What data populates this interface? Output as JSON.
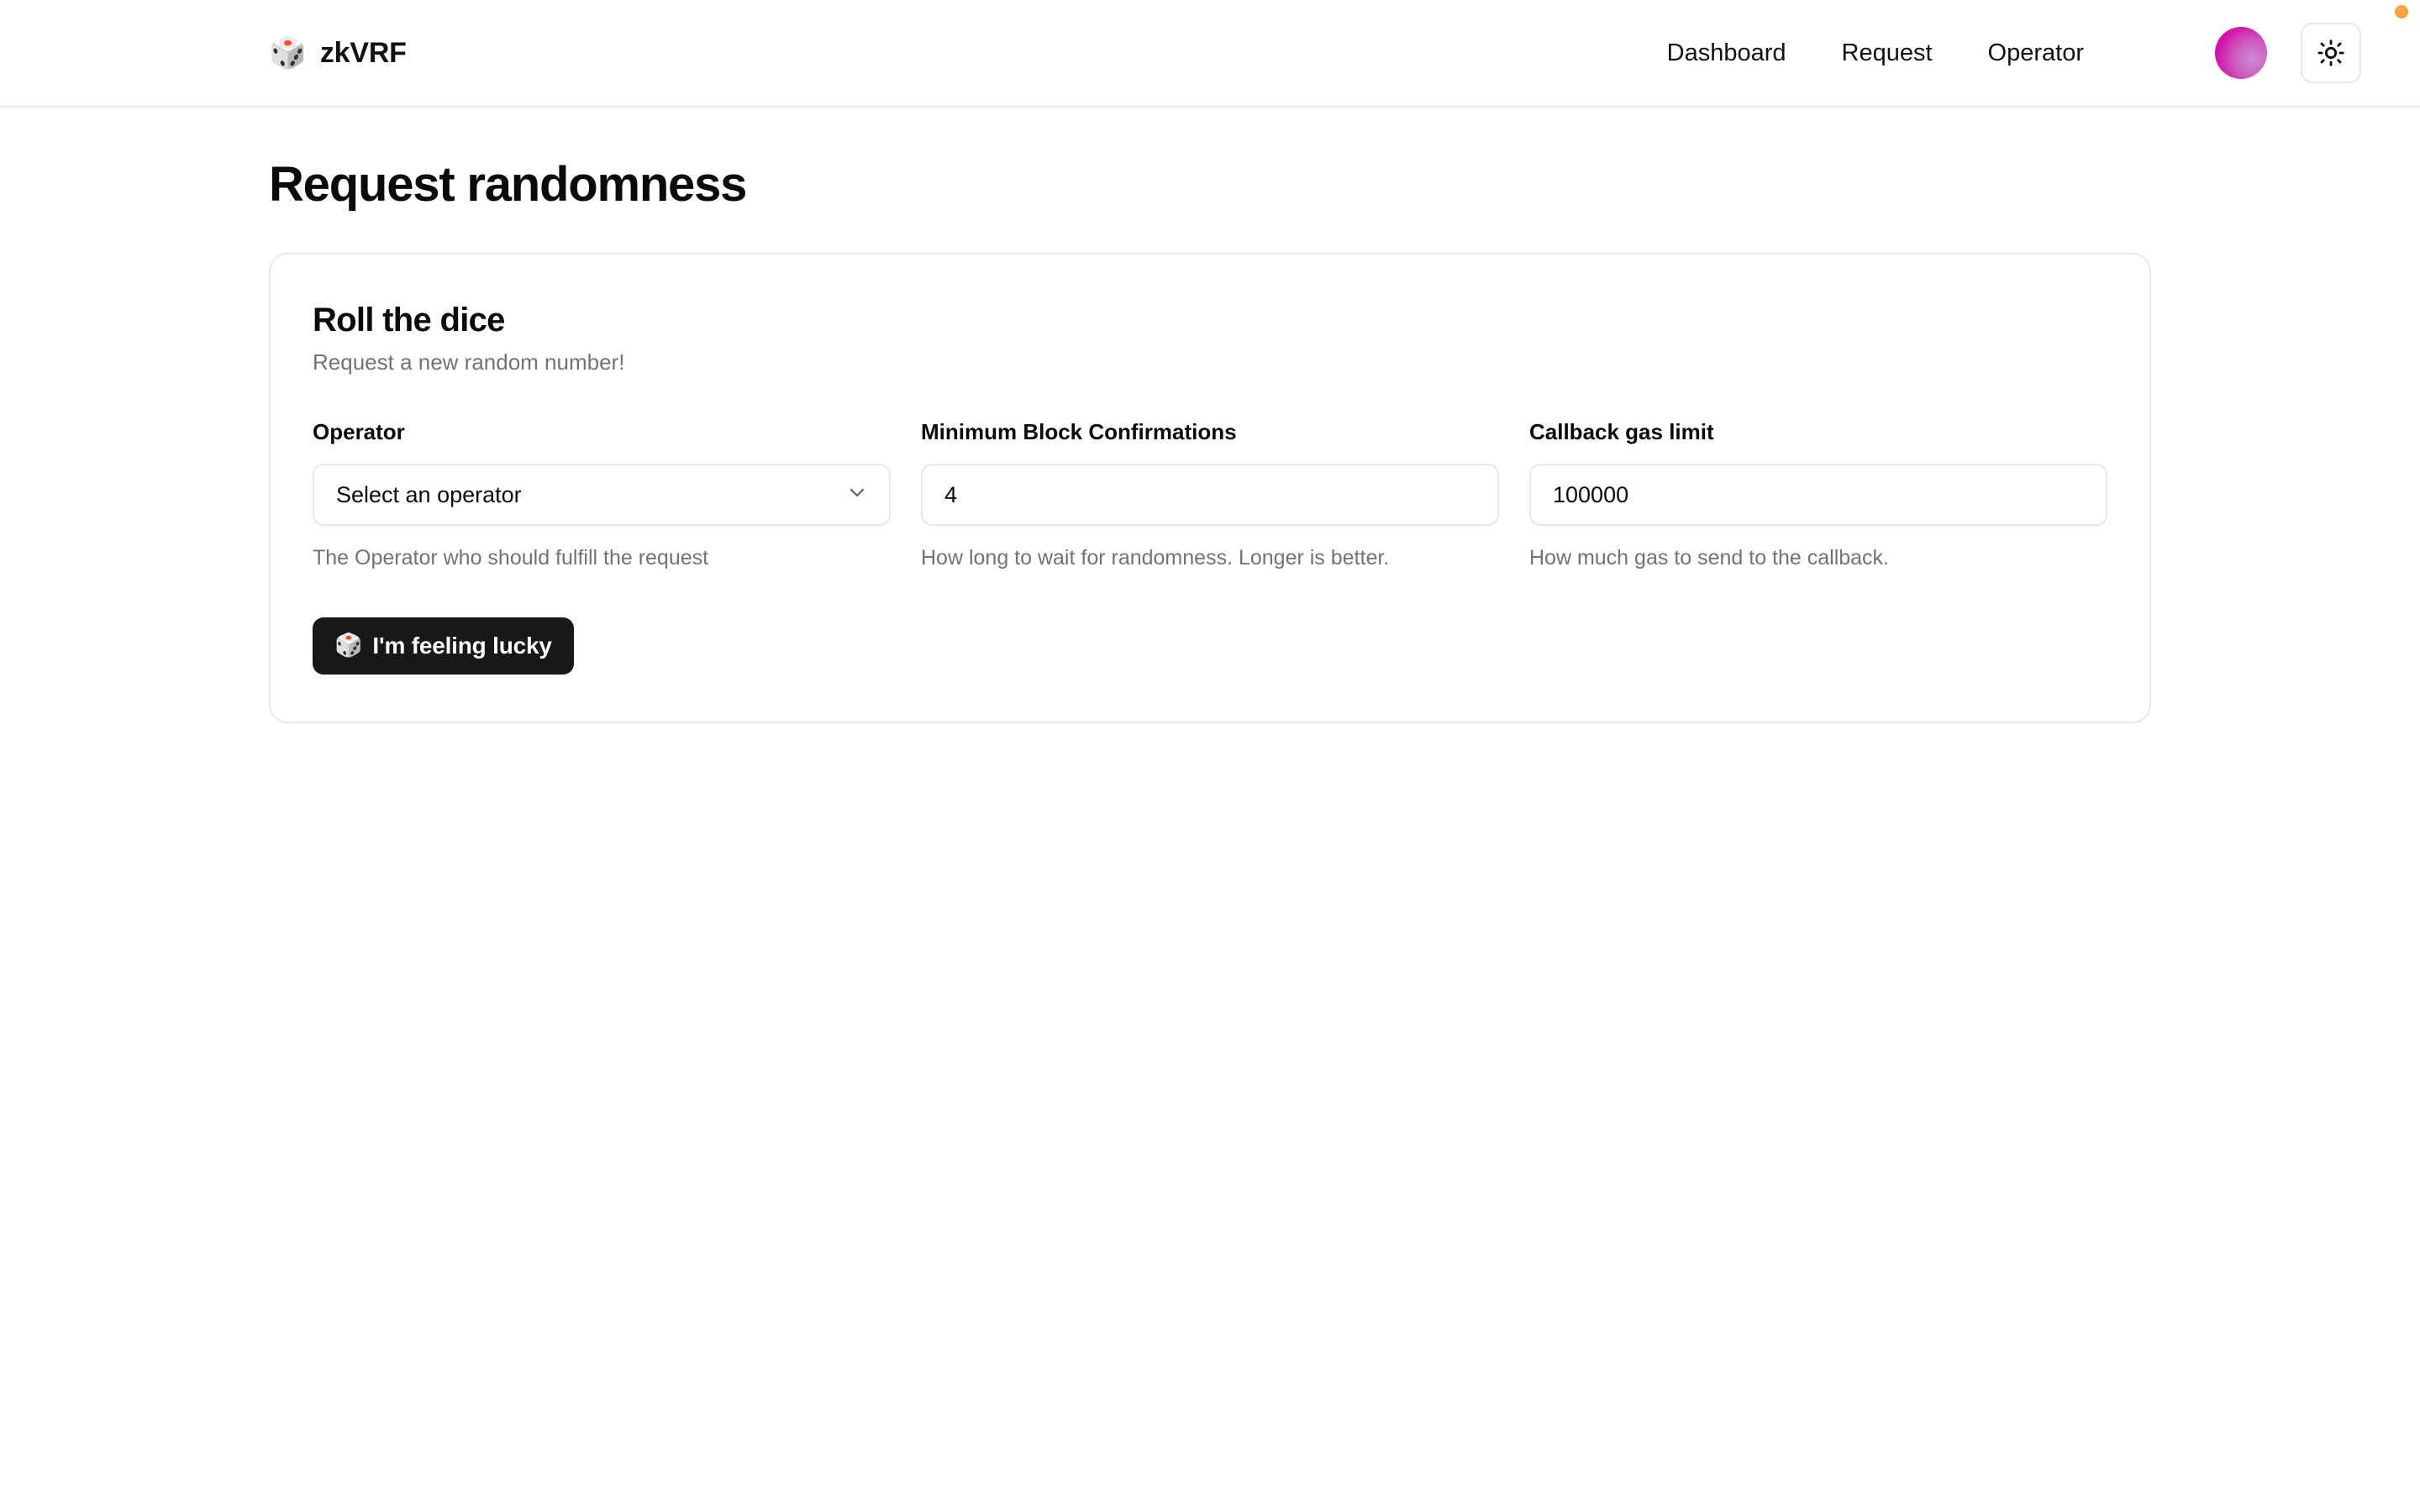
{
  "header": {
    "brand": {
      "logo_icon": "dice-icon",
      "logo_glyph": "🎲",
      "name": "zkVRF"
    },
    "nav": [
      {
        "label": "Dashboard"
      },
      {
        "label": "Request"
      },
      {
        "label": "Operator"
      }
    ],
    "avatar_icon": "avatar",
    "theme_toggle_icon": "sun-icon",
    "notification_dot_color": "#f5a33c"
  },
  "page": {
    "title": "Request randomness"
  },
  "card": {
    "title": "Roll the dice",
    "subtitle": "Request a new random number!",
    "fields": [
      {
        "label": "Operator",
        "type": "select",
        "value": "Select an operator",
        "icon": "chevron-down-icon",
        "help": "The Operator who should fulfill the request"
      },
      {
        "label": "Minimum Block Confirmations",
        "type": "number",
        "value": "4",
        "help": "How long to wait for randomness. Longer is better."
      },
      {
        "label": "Callback gas limit",
        "type": "number",
        "value": "100000",
        "help": "How much gas to send to the callback."
      }
    ],
    "submit": {
      "emoji": "🎲",
      "icon": "dice-icon",
      "label": "I'm feeling lucky",
      "background": "#18181b"
    }
  }
}
